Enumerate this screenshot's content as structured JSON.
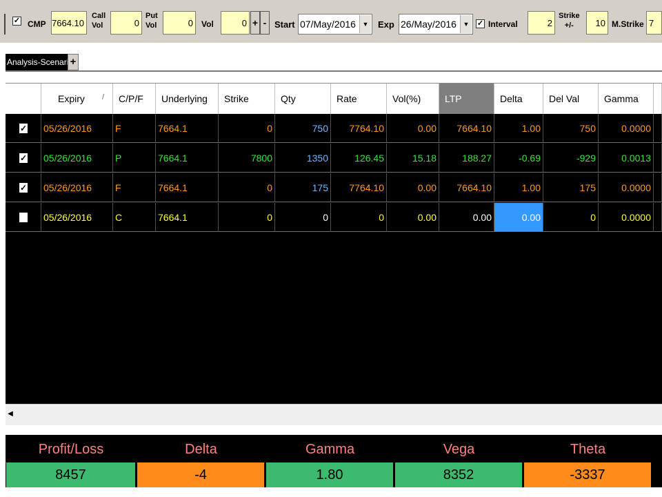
{
  "toolbar": {
    "cmp_label": "CMP",
    "cmp_value": "7664.10",
    "call_vol_label": [
      "Call",
      "Vol"
    ],
    "call_vol_value": "0",
    "put_vol_label": [
      "Put",
      "Vol"
    ],
    "put_vol_value": "0",
    "vol_label": "Vol",
    "vol_value": "0",
    "plus_label": "+",
    "minus_label": "-",
    "start_label": "Start",
    "start_date": "07/May/2016",
    "exp_label": "Exp",
    "exp_date": "26/May/2016",
    "interval_label": "Interval",
    "interval_value": "2",
    "strike_label": [
      "Strike",
      "+/-"
    ],
    "strike_value": "10",
    "mstrike_label": "M.Strike",
    "mstrike_value": "7",
    "check_mark": "✓"
  },
  "tabs": {
    "active": "Analysis-Scenario",
    "add_label": "+"
  },
  "grid": {
    "columns": [
      "",
      "Expiry",
      "C/P/F",
      "Underlying",
      "Strike",
      "Qty",
      "Rate",
      "Vol(%)",
      "LTP",
      "Delta",
      "Del Val",
      "Gamma"
    ],
    "sort_glyph": "/",
    "rows": [
      {
        "checked": true,
        "expiry": "05/26/2016",
        "cpf": "F",
        "underlying": "7664.1",
        "strike": "0",
        "qty": "750",
        "rate": "7764.10",
        "vol": "0.00",
        "ltp": "7664.10",
        "delta": "1.00",
        "delval": "750",
        "gamma": "0.0000"
      },
      {
        "checked": true,
        "expiry": "05/26/2016",
        "cpf": "P",
        "underlying": "7664.1",
        "strike": "7800",
        "qty": "1350",
        "rate": "126.45",
        "vol": "15.18",
        "ltp": "188.27",
        "delta": "-0.69",
        "delval": "-929",
        "gamma": "0.0013"
      },
      {
        "checked": true,
        "expiry": "05/26/2016",
        "cpf": "F",
        "underlying": "7664.1",
        "strike": "0",
        "qty": "175",
        "rate": "7764.10",
        "vol": "0.00",
        "ltp": "7664.10",
        "delta": "1.00",
        "delval": "175",
        "gamma": "0.0000"
      },
      {
        "checked": false,
        "expiry": "05/26/2016",
        "cpf": "C",
        "underlying": "7664.1",
        "strike": "0",
        "qty": "0",
        "rate": "0",
        "vol": "0.00",
        "ltp": "0.00",
        "delta": "0.00",
        "delval": "0",
        "gamma": "0.0000"
      }
    ]
  },
  "scroll": {
    "left_arrow": "◀"
  },
  "summary": {
    "headers": [
      "Profit/Loss",
      "Delta",
      "Gamma",
      "Vega",
      "Theta"
    ],
    "values": [
      "8457",
      "-4",
      "1.80",
      "8352",
      "-3337"
    ]
  },
  "colors": {
    "orange": "#ff9a1f",
    "green": "#33e633",
    "yellow": "#ffff33",
    "blue": "#6cb6ff",
    "summary_green": "#3cba6e",
    "summary_orange": "#ff8c1a"
  }
}
